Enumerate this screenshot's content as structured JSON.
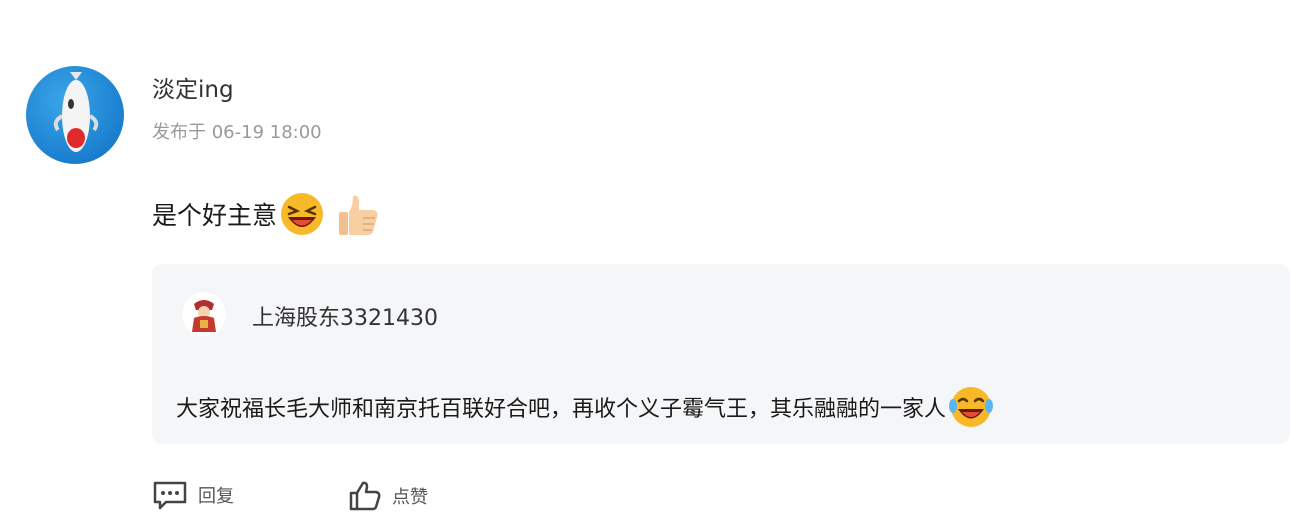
{
  "post": {
    "username": "淡定ing",
    "timestamp": "发布于 06-19 18:00",
    "comment_text": "是个好主意",
    "comment_emojis": [
      "laugh-emoji",
      "thumbs-up-emoji"
    ]
  },
  "quoted": {
    "username": "上海股东3321430",
    "text": "大家祝福长毛大师和南京托百联好合吧，再收个义子霉气王，其乐融融的一家人",
    "emoji": "tears-of-joy-emoji"
  },
  "actions": {
    "reply_label": "回复",
    "like_label": "点赞"
  },
  "colors": {
    "quote_bg": "#f5f6f8",
    "muted_text": "#9a9a9a",
    "avatar_blue": "#1b7fd0"
  }
}
